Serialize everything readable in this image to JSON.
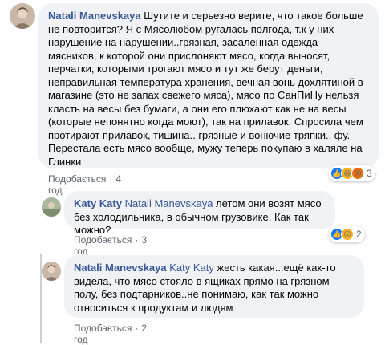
{
  "comments": [
    {
      "author": "Natali Manevskaya",
      "mention": "",
      "text": "Шутите и серьезно верите, что такое больше не повторится? Я с Мясолюбом ругалась полгода, т.к у них нарушение на нарушении..грязная, засаленная одежда мясников, к которой они прислоняют мясо, когда выносят, перчатки, которыми трогают мясо и тут же берут деньги, неправильная температура хранения, вечная вонь дохлятиной в магазине (это не запах свежего мяса), мясо по СанПиНу нельзя класть на весы без бумаги, а они его плюхают как не на весы (которые непонятно когда моют), так на прилавок. Спросила чем протирают прилавок, тишина.. грязные и вонючие тряпки.. фу. Перестала есть мясо вообще, мужу теперь покупаю в халяле на Глинки",
      "like_label": "Подобається",
      "time": "4 год",
      "reaction_count": "3"
    },
    {
      "author": "Katy Katy",
      "mention": "Natali Manevskaya",
      "text": "летом они возят мясо без холодильника, в обычном грузовике. Как так можно?",
      "like_label": "Подобається",
      "time": "3 год",
      "reaction_count": "2"
    },
    {
      "author": "Natali Manevskaya",
      "mention": "Katy Katy",
      "text": "жесть какая...ещё как-то видела, что мясо стояло в ящиках прямо на грязном полу, без подтарников..не понимаю, как так можно относиться к продуктам и людям",
      "like_label": "Подобається",
      "time": "2 год",
      "reaction_count": ""
    }
  ],
  "separator": "·",
  "colors": {
    "author": "#385898",
    "bubble": "#f0f2f5",
    "meta": "#606770"
  },
  "icons": [
    "like-icon",
    "haha-icon",
    "angry-icon",
    "wow-icon"
  ]
}
